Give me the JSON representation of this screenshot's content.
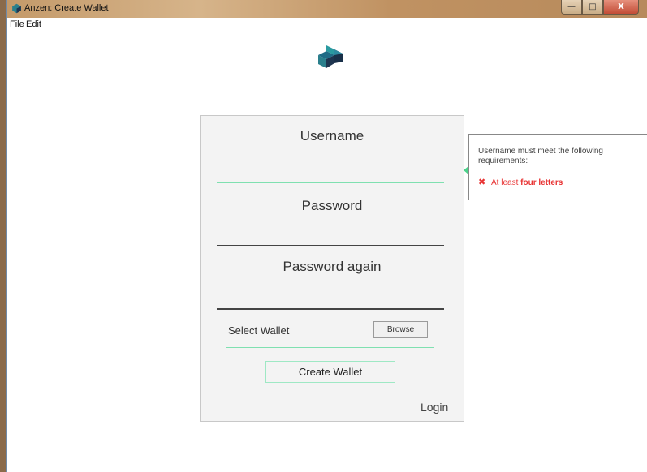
{
  "window": {
    "title": "Anzen: Create Wallet",
    "controls": {
      "minimize": "—",
      "maximize": "□",
      "close": "X"
    }
  },
  "menu": {
    "file": "File",
    "edit": "Edit"
  },
  "form": {
    "username_label": "Username",
    "username_value": "",
    "password_label": "Password",
    "password_value": "",
    "password_again_label": "Password again",
    "password_again_value": "",
    "select_wallet_label": "Select Wallet",
    "browse_label": "Browse",
    "create_wallet_label": "Create Wallet",
    "login_label": "Login"
  },
  "tooltip": {
    "message": "Username must meet the following requirements:",
    "requirement_prefix": "At least ",
    "requirement_emphasis": "four letters",
    "status_icon": "cross-icon"
  },
  "colors": {
    "accent_green": "#7fe0b0",
    "error_red": "#e83434",
    "logo_teal": "#2a7f8c",
    "logo_navy": "#1e3550"
  }
}
